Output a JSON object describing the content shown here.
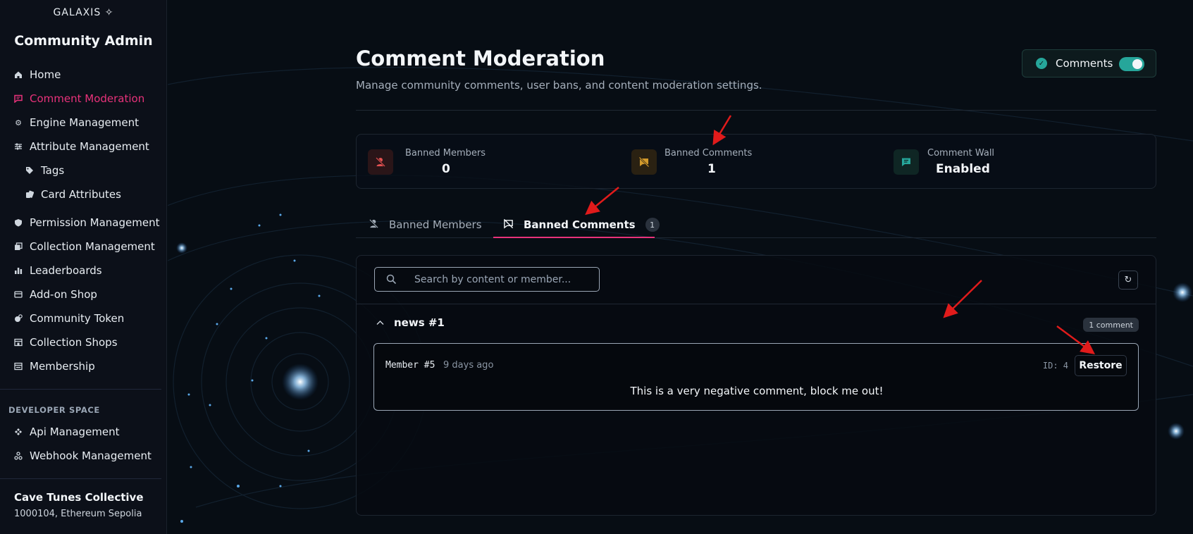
{
  "sidebar": {
    "logo": "GALAXIS",
    "title": "Community Admin",
    "items": [
      {
        "label": "Home",
        "icon": "home-icon"
      },
      {
        "label": "Comment Moderation",
        "icon": "comment-icon",
        "active": true
      },
      {
        "label": "Engine Management",
        "icon": "gear-icon"
      },
      {
        "label": "Attribute Management",
        "icon": "sliders-icon"
      },
      {
        "label": "Tags",
        "icon": "tag-icon"
      },
      {
        "label": "Card Attributes",
        "icon": "cards-icon"
      },
      {
        "label": "Permission Management",
        "icon": "shield-icon"
      },
      {
        "label": "Collection Management",
        "icon": "collection-icon"
      },
      {
        "label": "Leaderboards",
        "icon": "bar-chart-icon"
      },
      {
        "label": "Add-on Shop",
        "icon": "shop-icon"
      },
      {
        "label": "Community Token",
        "icon": "token-icon"
      },
      {
        "label": "Collection Shops",
        "icon": "store-icon"
      },
      {
        "label": "Membership",
        "icon": "membership-icon"
      }
    ],
    "developer_section": "DEVELOPER SPACE",
    "developer_items": [
      {
        "label": "Api Management",
        "icon": "api-icon"
      },
      {
        "label": "Webhook Management",
        "icon": "webhook-icon"
      }
    ],
    "org": {
      "name": "Cave Tunes Collective",
      "meta": "1000104, Ethereum Sepolia"
    }
  },
  "header": {
    "title": "Comment Moderation",
    "subtitle": "Manage community comments, user bans, and content moderation settings.",
    "toggle_label": "Comments",
    "toggle_on": true
  },
  "stats": [
    {
      "label": "Banned Members",
      "value": "0",
      "icon": "user-ban-icon",
      "color": "#e35151"
    },
    {
      "label": "Banned Comments",
      "value": "1",
      "icon": "comment-ban-icon",
      "color": "#d39a2c"
    },
    {
      "label": "Comment Wall",
      "value": "Enabled",
      "icon": "comment-wall-icon",
      "color": "#26a69a"
    }
  ],
  "tabs": [
    {
      "label": "Banned Members",
      "icon": "user-ban-icon"
    },
    {
      "label": "Banned Comments",
      "icon": "comment-ban-icon",
      "count": "1",
      "active": true
    }
  ],
  "panel": {
    "search_placeholder": "Search by content or member...",
    "group": {
      "title": "news #1",
      "count_label": "1 comment",
      "comments": [
        {
          "member": "Member #5",
          "time": "9 days ago",
          "id_label": "ID: 4",
          "action": "Restore",
          "text": "This is a very negative comment, block me out!"
        }
      ]
    }
  },
  "colors": {
    "accent": "#e8327a",
    "teal": "#26a69a",
    "annotation_arrow": "#e01b1b"
  }
}
